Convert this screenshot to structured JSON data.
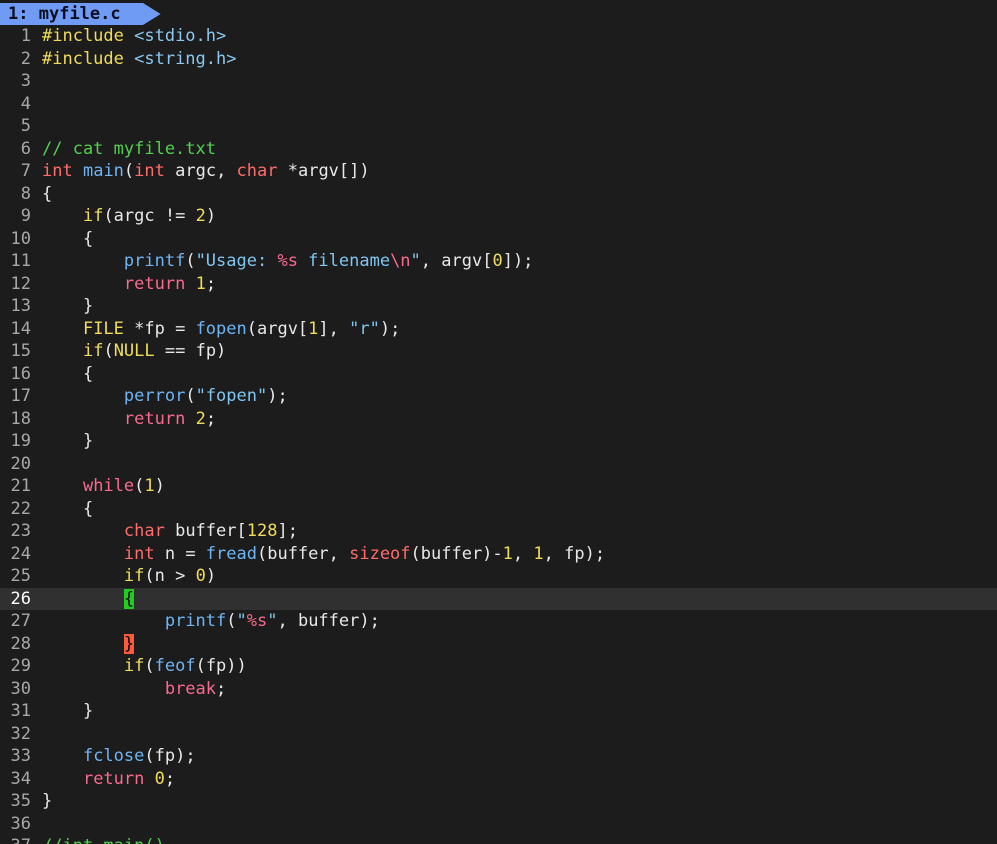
{
  "tab": {
    "number": "1:",
    "filename": "myfile.c"
  },
  "editor": {
    "current_line": 26,
    "colors": {
      "background": "#1c1c1c",
      "cursorline": "#303030",
      "tab_bg": "#6f9bf5",
      "keyword": "#f0dc5a",
      "type": "#ff6c6c",
      "function": "#6fb4f5",
      "comment": "#52d052",
      "match_brace_open": "#22cc22",
      "match_brace_close": "#ff5a3c"
    },
    "lines": [
      {
        "n": "1",
        "tokens": [
          [
            "pre",
            "#include "
          ],
          [
            "inc",
            "<stdio.h>"
          ]
        ]
      },
      {
        "n": "2",
        "tokens": [
          [
            "pre",
            "#include "
          ],
          [
            "inc",
            "<string.h>"
          ]
        ]
      },
      {
        "n": "3",
        "tokens": []
      },
      {
        "n": "4",
        "tokens": []
      },
      {
        "n": "5",
        "tokens": []
      },
      {
        "n": "6",
        "tokens": [
          [
            "cmt",
            "// cat myfile.txt"
          ]
        ]
      },
      {
        "n": "7",
        "tokens": [
          [
            "type",
            "int"
          ],
          [
            "pl",
            " "
          ],
          [
            "fn",
            "main"
          ],
          [
            "pl",
            "("
          ],
          [
            "type",
            "int"
          ],
          [
            "pl",
            " argc, "
          ],
          [
            "type",
            "char"
          ],
          [
            "pl",
            " *argv[])"
          ]
        ]
      },
      {
        "n": "8",
        "tokens": [
          [
            "pl",
            "{"
          ]
        ]
      },
      {
        "n": "9",
        "tokens": [
          [
            "pl",
            "    "
          ],
          [
            "kw",
            "if"
          ],
          [
            "pl",
            "(argc != "
          ],
          [
            "num",
            "2"
          ],
          [
            "pl",
            ")"
          ]
        ]
      },
      {
        "n": "10",
        "tokens": [
          [
            "pl",
            "    {"
          ]
        ]
      },
      {
        "n": "11",
        "tokens": [
          [
            "pl",
            "        "
          ],
          [
            "fn",
            "printf"
          ],
          [
            "pl",
            "("
          ],
          [
            "str",
            "\"Usage: "
          ],
          [
            "esc",
            "%s"
          ],
          [
            "str",
            " filename"
          ],
          [
            "esc",
            "\\n"
          ],
          [
            "str",
            "\""
          ],
          [
            "pl",
            ", argv["
          ],
          [
            "num",
            "0"
          ],
          [
            "pl",
            "]);"
          ]
        ]
      },
      {
        "n": "12",
        "tokens": [
          [
            "pl",
            "        "
          ],
          [
            "ret",
            "return"
          ],
          [
            "pl",
            " "
          ],
          [
            "num",
            "1"
          ],
          [
            "pl",
            ";"
          ]
        ]
      },
      {
        "n": "13",
        "tokens": [
          [
            "pl",
            "    }"
          ]
        ]
      },
      {
        "n": "14",
        "tokens": [
          [
            "pl",
            "    "
          ],
          [
            "cons",
            "FILE"
          ],
          [
            "pl",
            " *fp = "
          ],
          [
            "fn",
            "fopen"
          ],
          [
            "pl",
            "(argv["
          ],
          [
            "num",
            "1"
          ],
          [
            "pl",
            "], "
          ],
          [
            "str",
            "\"r\""
          ],
          [
            "pl",
            ");"
          ]
        ]
      },
      {
        "n": "15",
        "tokens": [
          [
            "pl",
            "    "
          ],
          [
            "kw",
            "if"
          ],
          [
            "pl",
            "("
          ],
          [
            "cons",
            "NULL"
          ],
          [
            "pl",
            " == fp)"
          ]
        ]
      },
      {
        "n": "16",
        "tokens": [
          [
            "pl",
            "    {"
          ]
        ]
      },
      {
        "n": "17",
        "tokens": [
          [
            "pl",
            "        "
          ],
          [
            "fn",
            "perror"
          ],
          [
            "pl",
            "("
          ],
          [
            "str",
            "\"fopen\""
          ],
          [
            "pl",
            ");"
          ]
        ]
      },
      {
        "n": "18",
        "tokens": [
          [
            "pl",
            "        "
          ],
          [
            "ret",
            "return"
          ],
          [
            "pl",
            " "
          ],
          [
            "num",
            "2"
          ],
          [
            "pl",
            ";"
          ]
        ]
      },
      {
        "n": "19",
        "tokens": [
          [
            "pl",
            "    }"
          ]
        ]
      },
      {
        "n": "20",
        "tokens": []
      },
      {
        "n": "21",
        "tokens": [
          [
            "pl",
            "    "
          ],
          [
            "ret",
            "while"
          ],
          [
            "pl",
            "("
          ],
          [
            "num",
            "1"
          ],
          [
            "pl",
            ")"
          ]
        ]
      },
      {
        "n": "22",
        "tokens": [
          [
            "pl",
            "    {"
          ]
        ]
      },
      {
        "n": "23",
        "tokens": [
          [
            "pl",
            "        "
          ],
          [
            "type",
            "char"
          ],
          [
            "pl",
            " buffer["
          ],
          [
            "num",
            "128"
          ],
          [
            "pl",
            "];"
          ]
        ]
      },
      {
        "n": "24",
        "tokens": [
          [
            "pl",
            "        "
          ],
          [
            "type",
            "int"
          ],
          [
            "pl",
            " n = "
          ],
          [
            "fn",
            "fread"
          ],
          [
            "pl",
            "(buffer, "
          ],
          [
            "type",
            "sizeof"
          ],
          [
            "pl",
            "(buffer)-"
          ],
          [
            "num",
            "1"
          ],
          [
            "pl",
            ", "
          ],
          [
            "num",
            "1"
          ],
          [
            "pl",
            ", fp);"
          ]
        ]
      },
      {
        "n": "25",
        "tokens": [
          [
            "pl",
            "        "
          ],
          [
            "kw",
            "if"
          ],
          [
            "pl",
            "(n > "
          ],
          [
            "num",
            "0"
          ],
          [
            "pl",
            ")"
          ]
        ]
      },
      {
        "n": "26",
        "tokens": [
          [
            "pl",
            "        "
          ],
          [
            "brace-open",
            "{"
          ]
        ]
      },
      {
        "n": "27",
        "tokens": [
          [
            "pl",
            "            "
          ],
          [
            "fn",
            "printf"
          ],
          [
            "pl",
            "("
          ],
          [
            "str",
            "\""
          ],
          [
            "esc",
            "%s"
          ],
          [
            "str",
            "\""
          ],
          [
            "pl",
            ", buffer);"
          ]
        ]
      },
      {
        "n": "28",
        "tokens": [
          [
            "pl",
            "        "
          ],
          [
            "brace-close",
            "}"
          ]
        ]
      },
      {
        "n": "29",
        "tokens": [
          [
            "pl",
            "        "
          ],
          [
            "kw",
            "if"
          ],
          [
            "pl",
            "("
          ],
          [
            "fn",
            "feof"
          ],
          [
            "pl",
            "(fp))"
          ]
        ]
      },
      {
        "n": "30",
        "tokens": [
          [
            "pl",
            "            "
          ],
          [
            "ret",
            "break"
          ],
          [
            "pl",
            ";"
          ]
        ]
      },
      {
        "n": "31",
        "tokens": [
          [
            "pl",
            "    }"
          ]
        ]
      },
      {
        "n": "32",
        "tokens": []
      },
      {
        "n": "33",
        "tokens": [
          [
            "pl",
            "    "
          ],
          [
            "fn",
            "fclose"
          ],
          [
            "pl",
            "(fp);"
          ]
        ]
      },
      {
        "n": "34",
        "tokens": [
          [
            "pl",
            "    "
          ],
          [
            "ret",
            "return"
          ],
          [
            "pl",
            " "
          ],
          [
            "num",
            "0"
          ],
          [
            "pl",
            ";"
          ]
        ]
      },
      {
        "n": "35",
        "tokens": [
          [
            "pl",
            "}"
          ]
        ]
      },
      {
        "n": "36",
        "tokens": []
      },
      {
        "n": "37",
        "tokens": [
          [
            "cmt",
            "//int main()"
          ]
        ]
      }
    ]
  }
}
